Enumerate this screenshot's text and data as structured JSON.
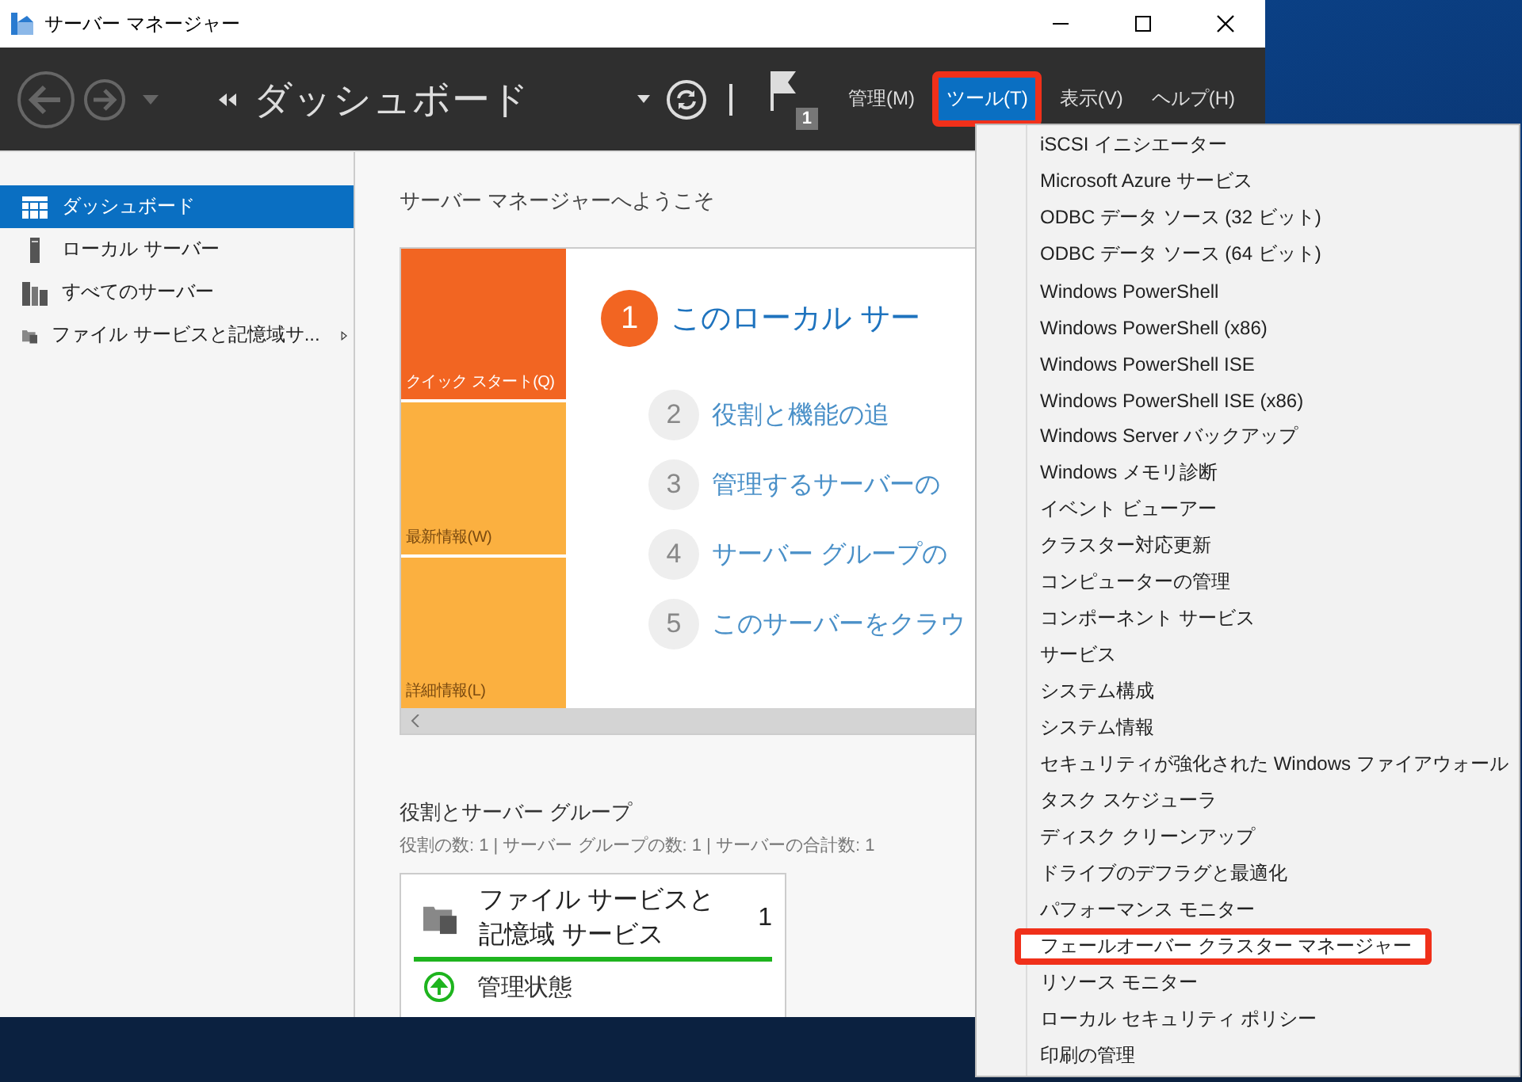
{
  "window": {
    "title": "サーバー マネージャー"
  },
  "toolbar": {
    "breadcrumb": "ダッシュボード",
    "notification_count": "1",
    "menus": [
      {
        "label": "管理(M)",
        "selected": false,
        "highlighted": false
      },
      {
        "label": "ツール(T)",
        "selected": true,
        "highlighted": true
      },
      {
        "label": "表示(V)",
        "selected": false,
        "highlighted": false
      },
      {
        "label": "ヘルプ(H)",
        "selected": false,
        "highlighted": false
      }
    ]
  },
  "sidebar": {
    "items": [
      {
        "label": "ダッシュボード",
        "kind": "dashboard",
        "selected": true,
        "has_submenu": false
      },
      {
        "label": "ローカル サーバー",
        "kind": "server",
        "selected": false,
        "has_submenu": false
      },
      {
        "label": "すべてのサーバー",
        "kind": "servers",
        "selected": false,
        "has_submenu": false
      },
      {
        "label": "ファイル サービスと記憶域サ...",
        "kind": "files",
        "selected": false,
        "has_submenu": true
      }
    ]
  },
  "welcome": {
    "heading": "サーバー マネージャーへようこそ",
    "tiles": [
      {
        "label": "クイック スタート(Q)",
        "selected": true
      },
      {
        "label": "最新情報(W)",
        "selected": false
      },
      {
        "label": "詳細情報(L)",
        "selected": false
      }
    ],
    "steps": [
      {
        "number": "1",
        "text": "このローカル サー",
        "selected": true
      },
      {
        "number": "2",
        "text": "役割と機能の追",
        "selected": false
      },
      {
        "number": "3",
        "text": "管理するサーバーの",
        "selected": false
      },
      {
        "number": "4",
        "text": "サーバー グループの",
        "selected": false
      },
      {
        "number": "5",
        "text": "このサーバーをクラウ",
        "selected": false
      }
    ]
  },
  "roles": {
    "heading": "役割とサーバー グループ",
    "summary": "役割の数: 1 | サーバー グループの数: 1 | サーバーの合計数: 1",
    "cards": [
      {
        "title": "ファイル サービスと記憶域 サービス",
        "count": "1",
        "color": "#1eb41e",
        "status": "管理状態"
      }
    ]
  },
  "tools_menu": {
    "items": [
      {
        "label": "iSCSI イニシエーター",
        "highlighted": false
      },
      {
        "label": "Microsoft Azure サービス",
        "highlighted": false
      },
      {
        "label": "ODBC データ ソース (32 ビット)",
        "highlighted": false
      },
      {
        "label": "ODBC データ ソース (64 ビット)",
        "highlighted": false
      },
      {
        "label": "Windows PowerShell",
        "highlighted": false
      },
      {
        "label": "Windows PowerShell (x86)",
        "highlighted": false
      },
      {
        "label": "Windows PowerShell ISE",
        "highlighted": false
      },
      {
        "label": "Windows PowerShell ISE (x86)",
        "highlighted": false
      },
      {
        "label": "Windows Server バックアップ",
        "highlighted": false
      },
      {
        "label": "Windows メモリ診断",
        "highlighted": false
      },
      {
        "label": "イベント ビューアー",
        "highlighted": false
      },
      {
        "label": "クラスター対応更新",
        "highlighted": false
      },
      {
        "label": "コンピューターの管理",
        "highlighted": false
      },
      {
        "label": "コンポーネント サービス",
        "highlighted": false
      },
      {
        "label": "サービス",
        "highlighted": false
      },
      {
        "label": "システム構成",
        "highlighted": false
      },
      {
        "label": "システム情報",
        "highlighted": false
      },
      {
        "label": "セキュリティが強化された Windows ファイアウォール",
        "highlighted": false
      },
      {
        "label": "タスク スケジューラ",
        "highlighted": false
      },
      {
        "label": "ディスク クリーンアップ",
        "highlighted": false
      },
      {
        "label": "ドライブのデフラグと最適化",
        "highlighted": false
      },
      {
        "label": "パフォーマンス モニター",
        "highlighted": false
      },
      {
        "label": "フェールオーバー クラスター マネージャー",
        "highlighted": true
      },
      {
        "label": "リソース モニター",
        "highlighted": false
      },
      {
        "label": "ローカル セキュリティ ポリシー",
        "highlighted": false
      },
      {
        "label": "印刷の管理",
        "highlighted": false
      }
    ]
  }
}
